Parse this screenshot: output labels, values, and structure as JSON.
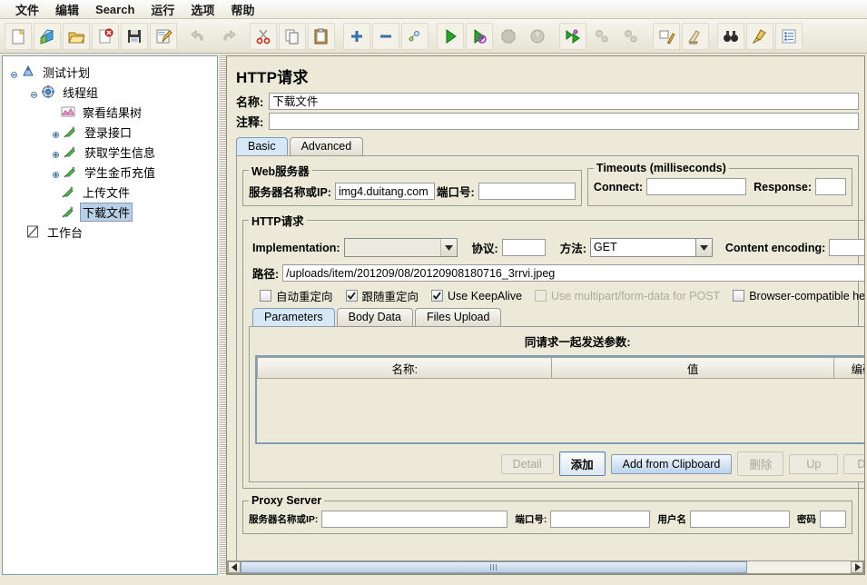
{
  "window": {
    "title": "HTTP请求"
  },
  "menu": {
    "items": [
      {
        "label": "文件",
        "name": "menu-file"
      },
      {
        "label": "编辑",
        "name": "menu-edit"
      },
      {
        "label": "Search",
        "name": "menu-search"
      },
      {
        "label": "运行",
        "name": "menu-run"
      },
      {
        "label": "选项",
        "name": "menu-options"
      },
      {
        "label": "帮助",
        "name": "menu-help"
      }
    ]
  },
  "toolbar": {
    "buttons": [
      {
        "icon": "new-file-icon",
        "enabled": true
      },
      {
        "icon": "templates-icon",
        "enabled": true
      },
      {
        "icon": "open-folder-icon",
        "enabled": true
      },
      {
        "icon": "close-file-icon",
        "enabled": true
      },
      {
        "icon": "save-icon",
        "enabled": true
      },
      {
        "icon": "save-as-icon",
        "enabled": true
      },
      {
        "icon": "undo-icon",
        "enabled": false
      },
      {
        "icon": "redo-icon",
        "enabled": false
      },
      {
        "icon": "cut-icon",
        "enabled": true
      },
      {
        "icon": "copy-icon",
        "enabled": true
      },
      {
        "icon": "paste-icon",
        "enabled": true
      },
      {
        "icon": "expand-all-icon",
        "enabled": true
      },
      {
        "icon": "collapse-all-icon",
        "enabled": true
      },
      {
        "icon": "toggle-icon",
        "enabled": true
      },
      {
        "icon": "start-icon",
        "enabled": true
      },
      {
        "icon": "start-no-pauses-icon",
        "enabled": true
      },
      {
        "icon": "stop-icon",
        "enabled": false
      },
      {
        "icon": "shutdown-icon",
        "enabled": false
      },
      {
        "icon": "remote-start-all-icon",
        "enabled": true
      },
      {
        "icon": "remote-stop-all-icon",
        "enabled": false
      },
      {
        "icon": "remote-shutdown-all-icon",
        "enabled": false
      },
      {
        "icon": "clear-icon",
        "enabled": true
      },
      {
        "icon": "clear-all-icon",
        "enabled": true
      },
      {
        "icon": "search-binoculars-icon",
        "enabled": true
      },
      {
        "icon": "reset-search-icon",
        "enabled": true
      },
      {
        "icon": "function-helper-icon",
        "enabled": true
      }
    ]
  },
  "tree": {
    "nodes": [
      {
        "label": "测试计划",
        "icon": "test-plan-icon",
        "depth": 0,
        "expanded": true,
        "selected": false
      },
      {
        "label": "线程组",
        "icon": "thread-group-icon",
        "depth": 1,
        "expanded": true,
        "selected": false
      },
      {
        "label": "察看结果树",
        "icon": "view-results-tree-icon",
        "depth": 2,
        "expanded": null,
        "selected": false
      },
      {
        "label": "登录接口",
        "icon": "http-sampler-icon",
        "depth": 2,
        "expanded": false,
        "selected": false
      },
      {
        "label": "获取学生信息",
        "icon": "http-sampler-icon",
        "depth": 2,
        "expanded": false,
        "selected": false
      },
      {
        "label": "学生金币充值",
        "icon": "http-sampler-icon",
        "depth": 2,
        "expanded": false,
        "selected": false
      },
      {
        "label": "上传文件",
        "icon": "http-sampler-icon",
        "depth": 2,
        "expanded": null,
        "selected": false
      },
      {
        "label": "下载文件",
        "icon": "http-sampler-icon",
        "depth": 2,
        "expanded": null,
        "selected": true
      },
      {
        "label": "工作台",
        "icon": "workbench-icon",
        "depth": 0,
        "expanded": null,
        "selected": false
      }
    ]
  },
  "panel": {
    "title": "HTTP请求",
    "name_label": "名称:",
    "name_value": "下载文件",
    "comment_label": "注释:",
    "comment_value": "",
    "tabs": [
      {
        "label": "Basic",
        "active": true
      },
      {
        "label": "Advanced",
        "active": false
      }
    ],
    "web_server": {
      "legend": "Web服务器",
      "server_label": "服务器名称或IP:",
      "server_value": "img4.duitang.com",
      "port_label": "端口号:",
      "port_value": ""
    },
    "timeouts": {
      "legend": "Timeouts (milliseconds)",
      "connect_label": "Connect:",
      "connect_value": "",
      "response_label": "Response:",
      "response_value": ""
    },
    "http_request": {
      "legend": "HTTP请求",
      "implementation_label": "Implementation:",
      "implementation_value": "",
      "protocol_label": "协议:",
      "protocol_value": "",
      "method_label": "方法:",
      "method_value": "GET",
      "content_encoding_label": "Content encoding:",
      "content_encoding_value": "",
      "path_label": "路径:",
      "path_value": "/uploads/item/201209/08/20120908180716_3rrvi.jpeg"
    },
    "checkboxes": [
      {
        "label": "自动重定向",
        "checked": false,
        "enabled": true,
        "name": "auto-redirect-checkbox"
      },
      {
        "label": "跟随重定向",
        "checked": true,
        "enabled": true,
        "name": "follow-redirects-checkbox"
      },
      {
        "label": "Use KeepAlive",
        "checked": true,
        "enabled": true,
        "name": "use-keepalive-checkbox"
      },
      {
        "label": "Use multipart/form-data for POST",
        "checked": false,
        "enabled": false,
        "name": "use-multipart-checkbox"
      },
      {
        "label": "Browser-compatible headers",
        "checked": false,
        "enabled": true,
        "name": "browser-compatible-headers-checkbox"
      }
    ],
    "param_tabs": [
      {
        "label": "Parameters",
        "active": true
      },
      {
        "label": "Body Data",
        "active": false
      },
      {
        "label": "Files Upload",
        "active": false
      }
    ],
    "params": {
      "heading": "同请求一起发送参数:",
      "columns": [
        "名称:",
        "值",
        "编码?"
      ],
      "rows": []
    },
    "param_buttons": [
      {
        "label": "Detail",
        "enabled": false,
        "style": "normal",
        "name": "detail-button"
      },
      {
        "label": "添加",
        "enabled": true,
        "style": "focus",
        "name": "add-button"
      },
      {
        "label": "Add from Clipboard",
        "enabled": true,
        "style": "primary",
        "name": "add-from-clipboard-button"
      },
      {
        "label": "删除",
        "enabled": false,
        "style": "normal",
        "name": "delete-button"
      },
      {
        "label": "Up",
        "enabled": false,
        "style": "normal",
        "name": "up-button"
      },
      {
        "label": "Down",
        "enabled": false,
        "style": "normal",
        "name": "down-button"
      }
    ],
    "proxy": {
      "legend": "Proxy Server",
      "server_label": "服务器名称或IP:",
      "server_value": "",
      "port_label": "端口号:",
      "port_value": "",
      "user_label": "用户名",
      "user_value": "",
      "password_label": "密码",
      "password_value": ""
    }
  },
  "colors": {
    "selection": "#b8cfe5",
    "tab_active": "#d6e8f7",
    "panel_bg": "#ece9d8",
    "border": "#7f9db9"
  }
}
